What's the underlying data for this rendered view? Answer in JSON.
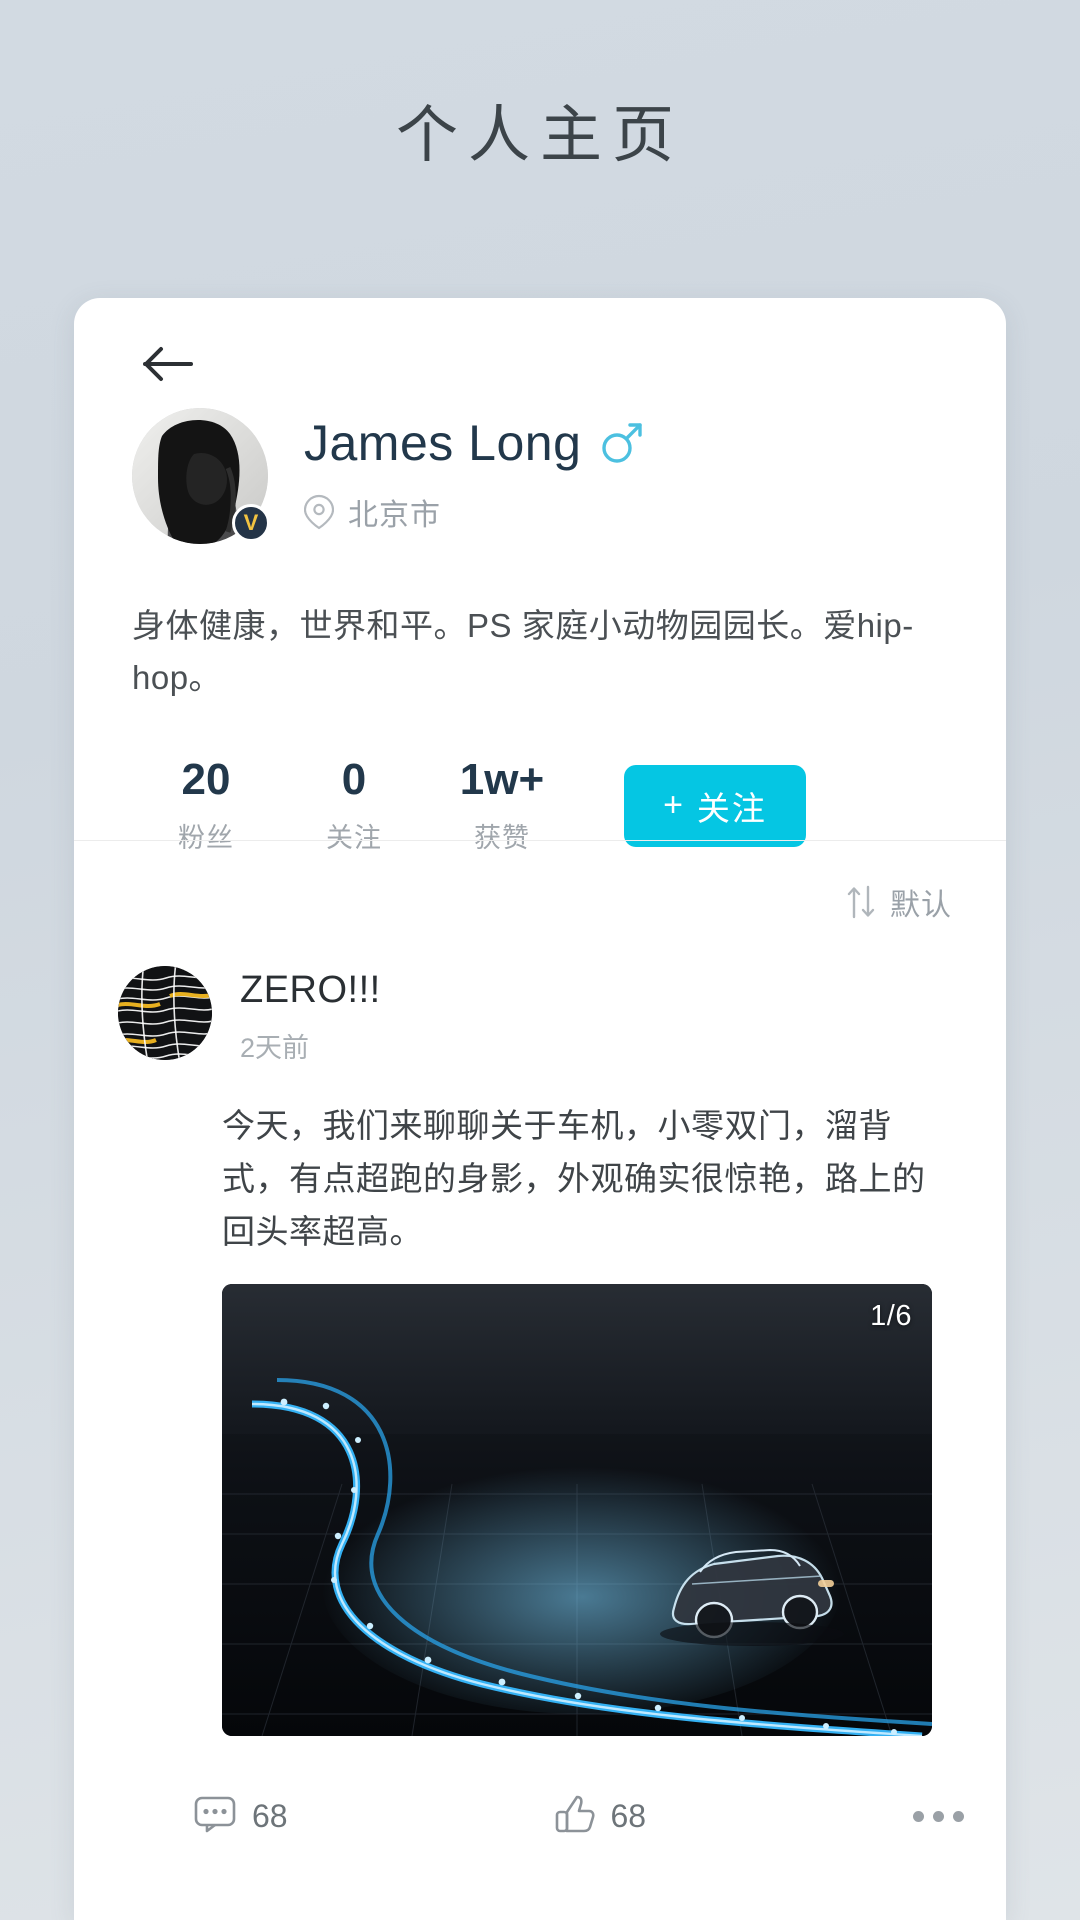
{
  "page": {
    "title": "个人主页"
  },
  "nav": {
    "back_icon": "arrow-left-icon"
  },
  "profile": {
    "avatar_icon": "user-avatar",
    "verified_badge": "V",
    "name": "James Long",
    "gender_icon": "male-icon",
    "location_icon": "map-pin-icon",
    "location": "北京市",
    "bio": "身体健康，世界和平。PS 家庭小动物园园长。爱hip-hop。",
    "stats": [
      {
        "value": "20",
        "label": "粉丝"
      },
      {
        "value": "0",
        "label": "关注"
      },
      {
        "value": "1w+",
        "label": "获赞"
      }
    ],
    "follow_button": {
      "plus": "+",
      "label": "关注"
    }
  },
  "feed": {
    "sort": {
      "icon": "sort-icon",
      "label": "默认"
    },
    "post": {
      "avatar_icon": "post-author-avatar",
      "author": "ZERO!!!",
      "time": "2天前",
      "text": "今天，我们来聊聊关于车机，小零双门，溜背式，有点超跑的身影，外观确实很惊艳，路上的回头率超高。",
      "media": {
        "counter": "1/6",
        "image_alt": "concept-car-light-trails"
      },
      "actions": {
        "comment_icon": "comment-icon",
        "comment_count": "68",
        "like_icon": "thumbs-up-icon",
        "like_count": "68",
        "more_icon": "more-dots-icon"
      }
    }
  },
  "colors": {
    "accent": "#05c6e3",
    "name": "#22384b",
    "gender": "#4cc0e0",
    "badge_bg": "#243447",
    "badge_text": "#f2c341",
    "muted": "#9aa1a8",
    "page_bg": "#d2dae2"
  }
}
